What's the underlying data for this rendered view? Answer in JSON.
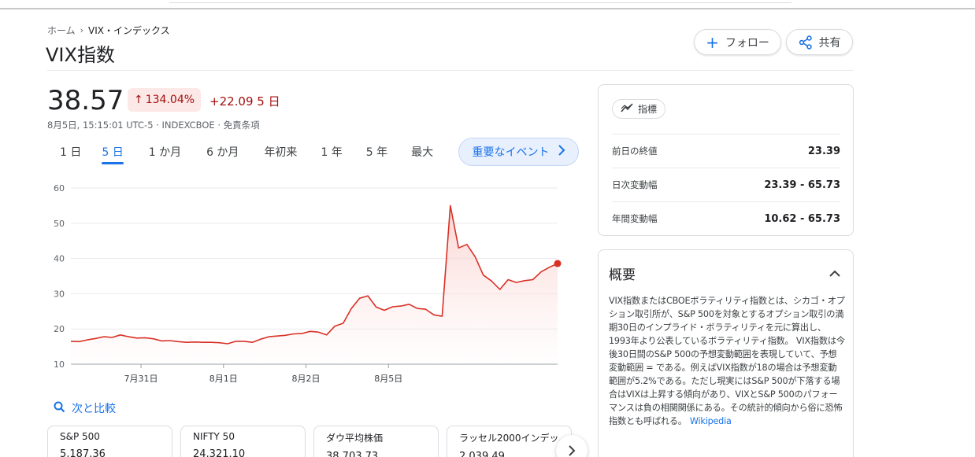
{
  "breadcrumb": {
    "home": "ホーム",
    "current": "VIX・インデックス"
  },
  "title": "VIX指数",
  "actions": {
    "follow": "フォロー",
    "share": "共有"
  },
  "quote": {
    "price": "38.57",
    "percent_change": "134.04%",
    "abs_change": "+22.09 5 日",
    "timestamp": "8月5日, 15:15:01 UTC-5 · INDEXCBOE · 免責条項"
  },
  "ranges": {
    "tabs": [
      "1 日",
      "5 日",
      "1 か月",
      "6 か月",
      "年初来",
      "1 年",
      "5 年",
      "最大"
    ],
    "active": "5 日",
    "events_label": "重要なイベント"
  },
  "colors": {
    "accent": "#1a73e8",
    "negative": "#d93025",
    "negative_dark": "#a50e0e",
    "badge_bg": "#fce8e6"
  },
  "chart_data": {
    "type": "area",
    "title": "",
    "xlabel": "",
    "ylabel": "",
    "ylim": [
      10,
      60
    ],
    "yticks": [
      10,
      20,
      30,
      40,
      50,
      60
    ],
    "grid": true,
    "x_ticks": [
      {
        "label": "7月31日",
        "index": 8.5
      },
      {
        "label": "8月1日",
        "index": 18.5
      },
      {
        "label": "8月2日",
        "index": 28.5
      },
      {
        "label": "8月5日",
        "index": 38.5
      }
    ],
    "series": [
      {
        "values": [
          16.5,
          16.4,
          16.9,
          17.3,
          17.8,
          17.6,
          18.3,
          17.8,
          17.4,
          17.5,
          17.2,
          16.6,
          16.7,
          16.4,
          16.2,
          16.3,
          16.2,
          16.2,
          16.1,
          15.8,
          16.5,
          16.5,
          16.2,
          17.1,
          17.8,
          18.0,
          18.2,
          18.6,
          18.7,
          19.3,
          19.1,
          18.3,
          20.8,
          21.6,
          25.8,
          28.7,
          29.4,
          26.2,
          25.3,
          26.3,
          26.5,
          27.0,
          25.8,
          25.6,
          24.0,
          23.6,
          55.0,
          43.0,
          44.0,
          40.5,
          35.3,
          33.6,
          31.2,
          34.0,
          33.2,
          33.7,
          34.0,
          36.2,
          37.5,
          38.57
        ]
      }
    ]
  },
  "compare": {
    "label": "次と比較"
  },
  "related": [
    {
      "name": "S&P 500",
      "value": "5,187.36"
    },
    {
      "name": "NIFTY 50",
      "value": "24,321.10"
    },
    {
      "name": "ダウ平均株価",
      "value": "38,703.73"
    },
    {
      "name": "ラッセル2000インデッ...",
      "value": "2,039.49"
    }
  ],
  "stats": {
    "chip": "指標",
    "rows": [
      {
        "label": "前日の終値",
        "value": "23.39"
      },
      {
        "label": "日次変動幅",
        "value": "23.39 - 65.73"
      },
      {
        "label": "年間変動幅",
        "value": "10.62 - 65.73"
      }
    ]
  },
  "about": {
    "title": "概要",
    "text": "VIX指数またはCBOEボラティリティ指数とは、シカゴ・オプション取引所が、S&P 500を対象とするオプション取引の満期30日のインプライド・ボラティリティを元に算出し、1993年より公表しているボラティリティ指数。 VIX指数は今後30日間のS&P 500の予想変動範囲を表現していて、予想変動範囲 = である。例えばVIX指数が18の場合は予想変動範囲が5.2%である。ただし現実にはS&P 500が下落する場合はVIXは上昇する傾向があり、VIXとS&P 500のパフォーマンスは負の相関関係にある。その統計的傾向から俗に恐怖指数とも呼ばれる。",
    "link": "Wikipedia"
  }
}
